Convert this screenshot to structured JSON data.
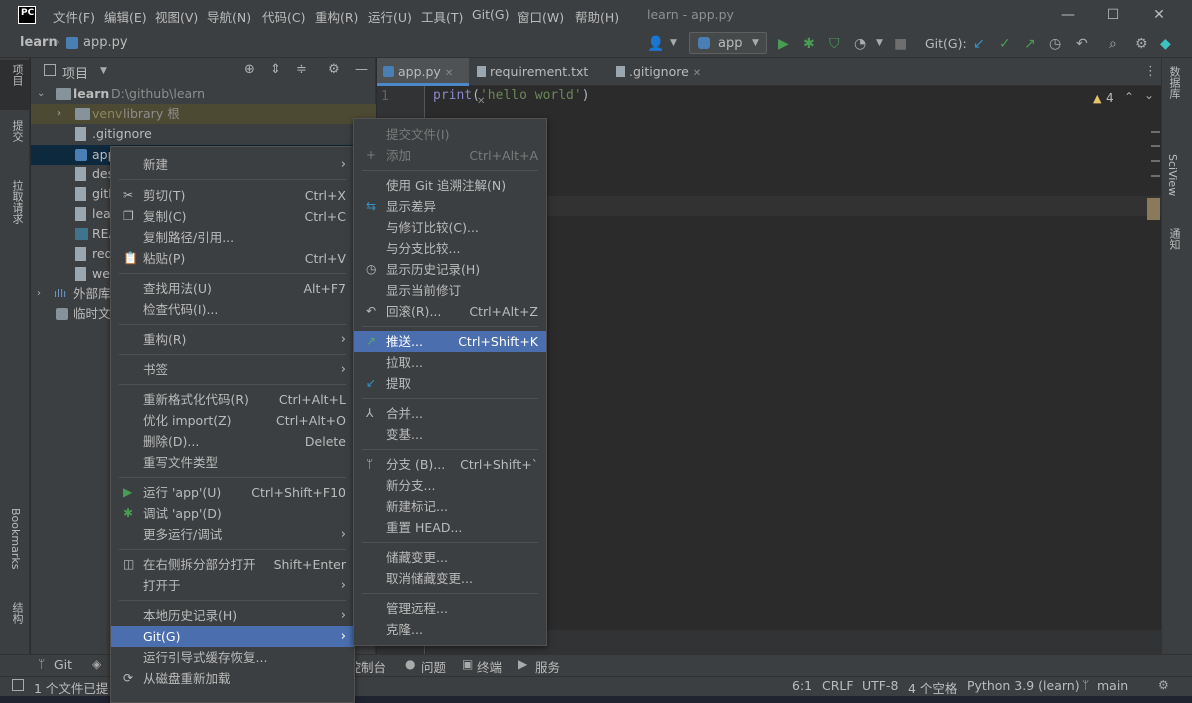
{
  "app": {
    "logo": "PC",
    "menus": [
      "文件(F)",
      "编辑(E)",
      "视图(V)",
      "导航(N)",
      "代码(C)",
      "重构(R)",
      "运行(U)",
      "工具(T)",
      "Git(G)",
      "窗口(W)",
      "帮助(H)"
    ],
    "window_title": "learn - app.py",
    "window_controls": [
      "minimize-icon",
      "maximize-icon",
      "close-icon"
    ]
  },
  "navbar": {
    "breadcrumb_project": "learn",
    "breadcrumb_file": "app.py",
    "run_config": "app",
    "git_label": "Git(G):"
  },
  "left_strip": [
    "项目",
    "提交",
    "拉取请求",
    "Bookmarks",
    "结构"
  ],
  "right_strip": [
    "数据库",
    "SciView",
    "通知"
  ],
  "project": {
    "header": "项目",
    "root": {
      "name": "learn",
      "path": "D:\\github\\learn"
    },
    "items": [
      {
        "name": "venv",
        "extra": "library 根",
        "icon": "folder-icon"
      },
      {
        "name": ".gitignore",
        "icon": "file-icon"
      },
      {
        "name": "app",
        "icon": "python-file-icon"
      },
      {
        "name": "des",
        "icon": "file-icon"
      },
      {
        "name": "gith",
        "icon": "file-icon"
      },
      {
        "name": "lear",
        "icon": "file-icon"
      },
      {
        "name": "REA",
        "icon": "markdown-file-icon"
      },
      {
        "name": "req",
        "icon": "file-icon"
      },
      {
        "name": "web",
        "icon": "file-icon"
      }
    ],
    "external": "外部库",
    "scratch": "临时文"
  },
  "editor": {
    "tabs": [
      {
        "label": "app.py",
        "active": true
      },
      {
        "label": "requirement.txt",
        "active": false
      },
      {
        "label": ".gitignore",
        "active": false
      }
    ],
    "line_number": "1",
    "code_func": "print",
    "code_str": "'hello world'",
    "warning_count": "4"
  },
  "context_menu": {
    "items": [
      {
        "label": "新建",
        "arrow": true
      },
      {
        "label": "剪切(T)",
        "shortcut": "Ctrl+X",
        "icon": "scissors-icon"
      },
      {
        "label": "复制(C)",
        "shortcut": "Ctrl+C",
        "icon": "copy-icon"
      },
      {
        "label": "复制路径/引用..."
      },
      {
        "label": "粘贴(P)",
        "shortcut": "Ctrl+V",
        "icon": "paste-icon"
      },
      {
        "label": "查找用法(U)",
        "shortcut": "Alt+F7"
      },
      {
        "label": "检查代码(I)..."
      },
      {
        "label": "重构(R)",
        "arrow": true
      },
      {
        "label": "书签",
        "arrow": true
      },
      {
        "label": "重新格式化代码(R)",
        "shortcut": "Ctrl+Alt+L"
      },
      {
        "label": "优化 import(Z)",
        "shortcut": "Ctrl+Alt+O"
      },
      {
        "label": "删除(D)...",
        "shortcut": "Delete"
      },
      {
        "label": "重写文件类型"
      },
      {
        "label": "运行 'app'(U)",
        "shortcut": "Ctrl+Shift+F10",
        "icon": "run-icon"
      },
      {
        "label": "调试 'app'(D)",
        "icon": "debug-icon"
      },
      {
        "label": "更多运行/调试",
        "arrow": true
      },
      {
        "label": "在右侧拆分部分打开",
        "shortcut": "Shift+Enter",
        "icon": "split-icon"
      },
      {
        "label": "打开于",
        "arrow": true
      },
      {
        "label": "本地历史记录(H)",
        "arrow": true
      },
      {
        "label": "Git(G)",
        "arrow": true,
        "selected": true
      },
      {
        "label": "运行引导式缓存恢复..."
      },
      {
        "label": "从磁盘重新加载",
        "icon": "reload-icon"
      }
    ]
  },
  "git_submenu": {
    "items": [
      {
        "label": "提交文件(I)",
        "disabled": true
      },
      {
        "label": "添加",
        "shortcut": "Ctrl+Alt+A",
        "disabled": true,
        "icon": "plus-icon"
      },
      {
        "label": "使用 Git 追溯注解(N)"
      },
      {
        "label": "显示差异",
        "icon": "diff-icon"
      },
      {
        "label": "与修订比较(C)..."
      },
      {
        "label": "与分支比较..."
      },
      {
        "label": "显示历史记录(H)",
        "icon": "history-icon"
      },
      {
        "label": "显示当前修订"
      },
      {
        "label": "回滚(R)...",
        "shortcut": "Ctrl+Alt+Z",
        "icon": "rollback-icon"
      },
      {
        "label": "推送...",
        "shortcut": "Ctrl+Shift+K",
        "selected": true,
        "icon": "push-icon"
      },
      {
        "label": "拉取..."
      },
      {
        "label": "提取",
        "icon": "fetch-icon"
      },
      {
        "label": "合并...",
        "icon": "merge-icon"
      },
      {
        "label": "变基..."
      },
      {
        "label": "分支 (B)...",
        "shortcut": "Ctrl+Shift+`",
        "icon": "branch-icon"
      },
      {
        "label": "新分支..."
      },
      {
        "label": "新建标记..."
      },
      {
        "label": "重置 HEAD..."
      },
      {
        "label": "储藏变更..."
      },
      {
        "label": "取消储藏变更..."
      },
      {
        "label": "管理远程..."
      },
      {
        "label": "克隆..."
      }
    ]
  },
  "bottom_tools": [
    "Git",
    "控制台",
    "问题",
    "终端",
    "服务"
  ],
  "status": {
    "message": "1 个文件已提",
    "position": "6:1",
    "line_sep": "CRLF",
    "encoding": "UTF-8",
    "indent": "4 个空格",
    "interpreter": "Python 3.9 (learn)",
    "branch": "main"
  },
  "colors": {
    "bg_panel": "#3c3f41",
    "bg_editor": "#2b2b2b",
    "selection": "#4b6eaf",
    "run_green": "#499c54",
    "keyword_yellow": "#ffc66d",
    "string_green": "#6a8759",
    "folder_blue": "#87939a"
  }
}
